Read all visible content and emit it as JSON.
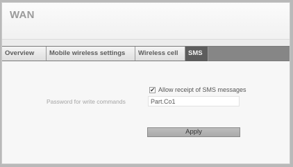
{
  "window": {
    "title": "WAN"
  },
  "tabs": [
    {
      "label": "Overview",
      "active": false
    },
    {
      "label": "Mobile wireless settings",
      "active": false
    },
    {
      "label": "Wireless cell",
      "active": false
    },
    {
      "label": "SMS",
      "active": true
    }
  ],
  "sms": {
    "allow_receipt_label": "Allow receipt of SMS messages",
    "allow_receipt_checked": true,
    "password_label": "Password for write commands",
    "password_value": "Part.Co1",
    "apply_label": "Apply"
  },
  "icons": {
    "checkbox_mark": "check-icon"
  },
  "colors": {
    "active_tab_bg": "#5d5d5d",
    "tabbar_bg": "#868686",
    "button_bg": "#b3b3b3"
  }
}
